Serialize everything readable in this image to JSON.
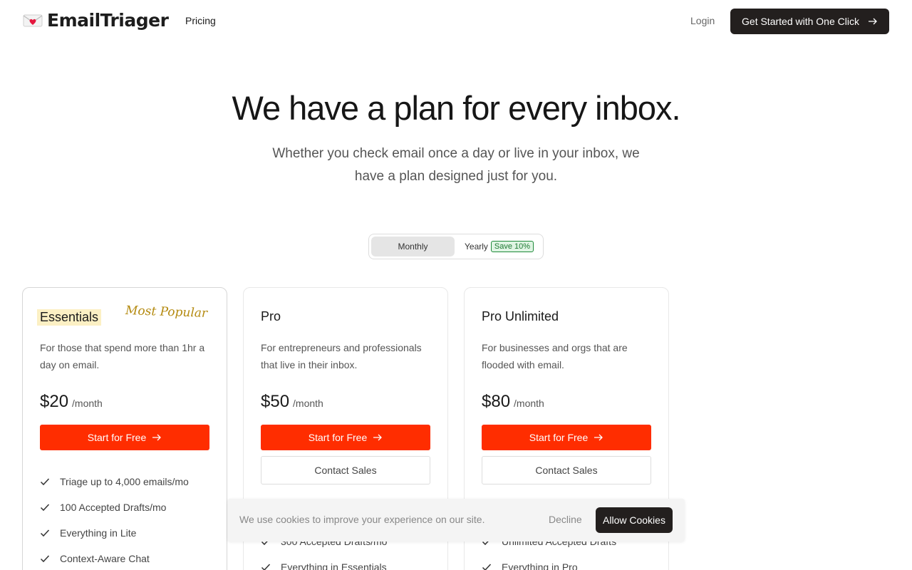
{
  "nav": {
    "brand": "EmailTriager",
    "pricing_link": "Pricing",
    "login": "Login",
    "cta": "Get Started with One Click"
  },
  "hero": {
    "title": "We have a plan for every inbox.",
    "subtitle": "Whether you check email once a day or live in your inbox, we have a plan designed just for you."
  },
  "billing_toggle": {
    "monthly": "Monthly",
    "yearly": "Yearly",
    "yearly_badge": "Save 10%",
    "selected": "Monthly"
  },
  "plans": [
    {
      "name": "Essentials",
      "tag": "Most Popular",
      "description": "For those that spend more than 1hr a day on email.",
      "price": "$20",
      "period": "/month",
      "start_label": "Start for Free",
      "features": [
        "Triage up to 4,000 emails/mo",
        "100 Accepted Drafts/mo",
        "Everything in Lite",
        "Context-Aware Chat"
      ]
    },
    {
      "name": "Pro",
      "description": "For entrepreneurs and professionals that live in their inbox.",
      "price": "$50",
      "period": "/month",
      "start_label": "Start for Free",
      "contact_label": "Contact Sales",
      "features": [
        "300 Accepted Drafts/mo",
        "Everything in Essentials"
      ]
    },
    {
      "name": "Pro Unlimited",
      "description": "For businesses and orgs that are flooded with email.",
      "price": "$80",
      "period": "/month",
      "start_label": "Start for Free",
      "contact_label": "Contact Sales",
      "features": [
        "Unlimited Accepted Drafts",
        "Everything in Pro"
      ]
    }
  ],
  "cookie_banner": {
    "text": "We use cookies to improve your experience on our site.",
    "decline": "Decline",
    "allow": "Allow Cookies"
  },
  "colors": {
    "primary_button": "#ff2d00",
    "dark_button": "#231f1e",
    "highlight": "#fcf0c4",
    "popular_text": "#b48a10",
    "save_badge": "#1f8a3a"
  },
  "icons": {
    "logo": "love-letter-icon",
    "arrow": "arrow-right-icon",
    "check": "check-icon"
  }
}
